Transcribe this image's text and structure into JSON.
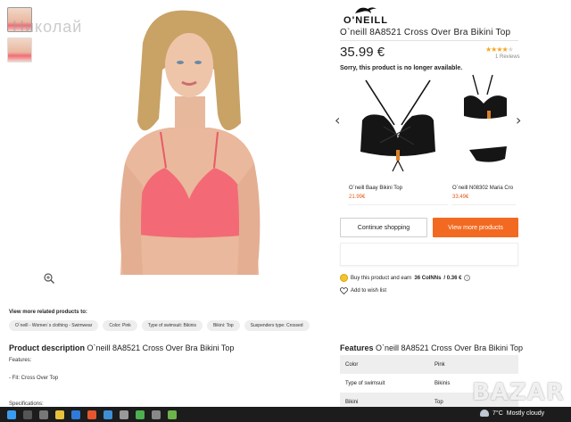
{
  "watermark": "Николай",
  "brand": {
    "name": "O'NEILL"
  },
  "product": {
    "title": "O`neill 8A8521 Cross Over Bra Bikini Top",
    "price": "35.99 €",
    "reviews": "1 Reviews",
    "rating": 4,
    "rating_max": 5,
    "availability": "Sorry, this product is no longer available."
  },
  "carousel": {
    "items": [
      {
        "name": "O`neill Baay Bikini Top",
        "price": "21.99€"
      },
      {
        "name": "O`neill N08302 Maria Cro",
        "price": "33.49€"
      }
    ]
  },
  "buttons": {
    "continue": "Continue shopping",
    "more": "View more products"
  },
  "coins": {
    "prefix": "Buy this product and earn",
    "amount": "36 CoINNs",
    "suffix": "/ 0.36 €",
    "info_icon": "i"
  },
  "wishlist": "Add to wish list",
  "related": {
    "heading": "View more related products to:",
    "tags": [
      "O`neill - Women`s clothing - Swimwear",
      "Color: Pink",
      "Type of swimsuit: Bikinis",
      "Bikini: Top",
      "Suspenders type: Crossed"
    ]
  },
  "description": {
    "heading_bold": "Product description",
    "heading_rest": "O`neill 8A8521 Cross Over Bra Bikini Top",
    "features_label": "Features:",
    "fit": "- Fit: Cross Over Top",
    "specs_label": "Specifications:"
  },
  "features": {
    "heading_bold": "Features",
    "heading_rest": "O`neill 8A8521 Cross Over Bra Bikini Top",
    "rows": [
      {
        "label": "Color",
        "value": "Pink"
      },
      {
        "label": "Type of swimsuit",
        "value": "Bikinis"
      },
      {
        "label": "Bikini",
        "value": "Top"
      }
    ]
  },
  "site_logo": "BAZAR",
  "taskbar": {
    "temperature": "7°C",
    "weather": "Mostly cloudy"
  },
  "colors": {
    "accent": "#f26a21",
    "price_orange": "#e25b14",
    "bikini_pink": "#f36a76",
    "star": "#f5a623"
  },
  "icons": [
    "zoom-icon",
    "chevron-left-icon",
    "chevron-right-icon",
    "coin-icon",
    "heart-icon",
    "weather-icon"
  ]
}
